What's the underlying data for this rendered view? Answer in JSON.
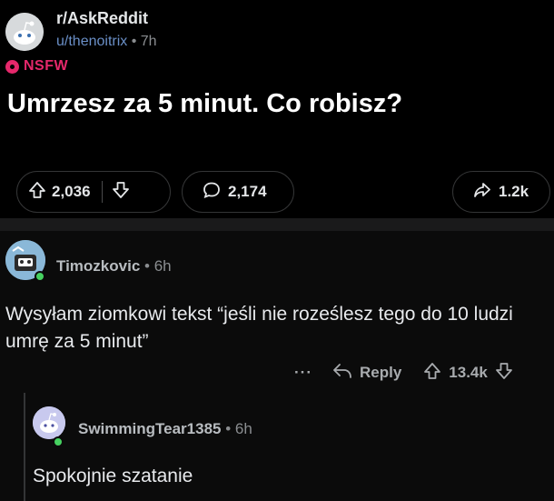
{
  "post": {
    "subreddit": "r/AskReddit",
    "username": "u/thenoitrix",
    "separator": "•",
    "time": "7h",
    "flair": "NSFW",
    "title": "Umrzesz za 5 minut. Co robisz?",
    "upvotes": "2,036",
    "comments": "2,174",
    "shares": "1.2k"
  },
  "comments": [
    {
      "username": "Timozkovic",
      "meta": "• 6h",
      "body": "Wysyłam ziomkowi tekst “jeśli nie roześlesz tego do 10 ludzi umrę za 5 minut”",
      "more": "···",
      "reply_label": "Reply",
      "score": "13.4k"
    },
    {
      "username": "SwimmingTear1385",
      "meta": "• 6h",
      "body": "Spokojnie szatanie"
    }
  ],
  "colors": {
    "background": "#000000",
    "nsfw": "#e5286b",
    "username_link": "#6a8fc7",
    "online": "#46d160"
  },
  "icons": [
    "subreddit-avatar-icon",
    "nsfw-icon",
    "upvote-icon",
    "downvote-icon",
    "comment-icon",
    "share-icon",
    "reply-icon",
    "more-icon",
    "user-avatar-icon"
  ]
}
